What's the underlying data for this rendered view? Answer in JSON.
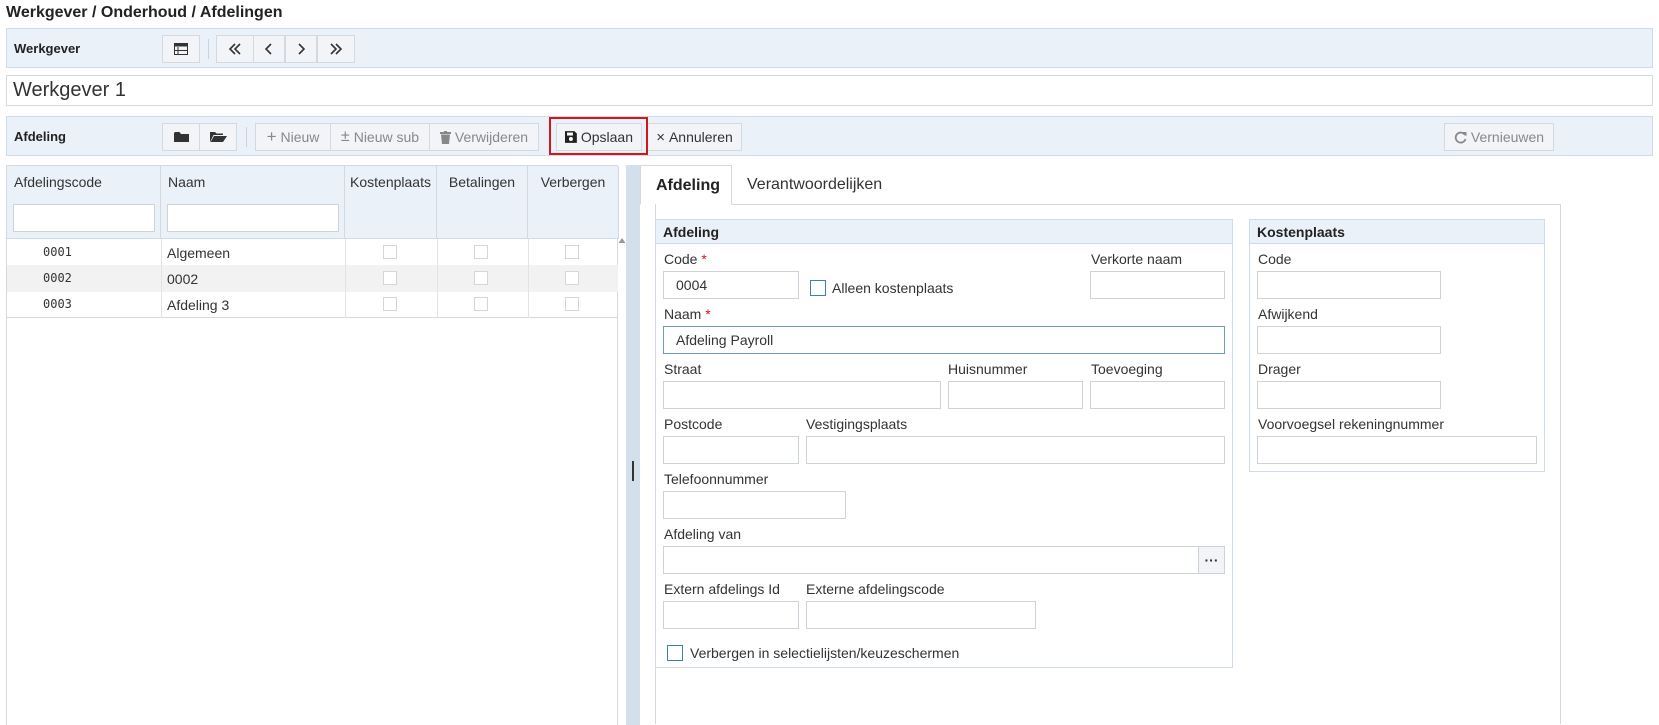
{
  "breadcrumb": "Werkgever / Onderhoud / Afdelingen",
  "werkgever_bar": {
    "label": "Werkgever"
  },
  "werkgever_title": "Werkgever 1",
  "afdeling_bar": {
    "label": "Afdeling",
    "new_label": "Nieuw",
    "new_sub_label": "Nieuw sub",
    "delete_label": "Verwijderen",
    "save_label": "Opslaan",
    "cancel_label": "Annuleren",
    "refresh_label": "Vernieuwen"
  },
  "grid": {
    "columns": [
      "Afdelingscode",
      "Naam",
      "Kostenplaats",
      "Betalingen",
      "Verbergen"
    ],
    "rows": [
      {
        "code": "0001",
        "name": "Algemeen"
      },
      {
        "code": "0002",
        "name": "0002"
      },
      {
        "code": "0003",
        "name": "Afdeling 3"
      }
    ]
  },
  "tabs": [
    "Afdeling",
    "Verantwoordelijken"
  ],
  "afdeling_panel": {
    "title": "Afdeling",
    "code_label": "Code",
    "code_value": "0004",
    "alleen_kostenplaats_label": "Alleen kostenplaats",
    "verkorte_naam_label": "Verkorte naam",
    "naam_label": "Naam",
    "naam_value": "Afdeling Payroll",
    "straat_label": "Straat",
    "huisnummer_label": "Huisnummer",
    "toevoeging_label": "Toevoeging",
    "postcode_label": "Postcode",
    "vestigingsplaats_label": "Vestigingsplaats",
    "telefoonnummer_label": "Telefoonnummer",
    "afdeling_van_label": "Afdeling van",
    "extern_id_label": "Extern afdelings Id",
    "externe_code_label": "Externe afdelingscode",
    "verbergen_label": "Verbergen in selectielijsten/keuzeschermen",
    "required_mark": "*"
  },
  "kostenplaats_panel": {
    "title": "Kostenplaats",
    "code_label": "Code",
    "afwijkend_label": "Afwijkend",
    "drager_label": "Drager",
    "voorvoegsel_label": "Voorvoegsel rekeningnummer"
  },
  "colors": {
    "bar_bg": "#eaf1f9",
    "highlight": "#d8141b",
    "checkbox_blue": "#3b7ec5"
  }
}
